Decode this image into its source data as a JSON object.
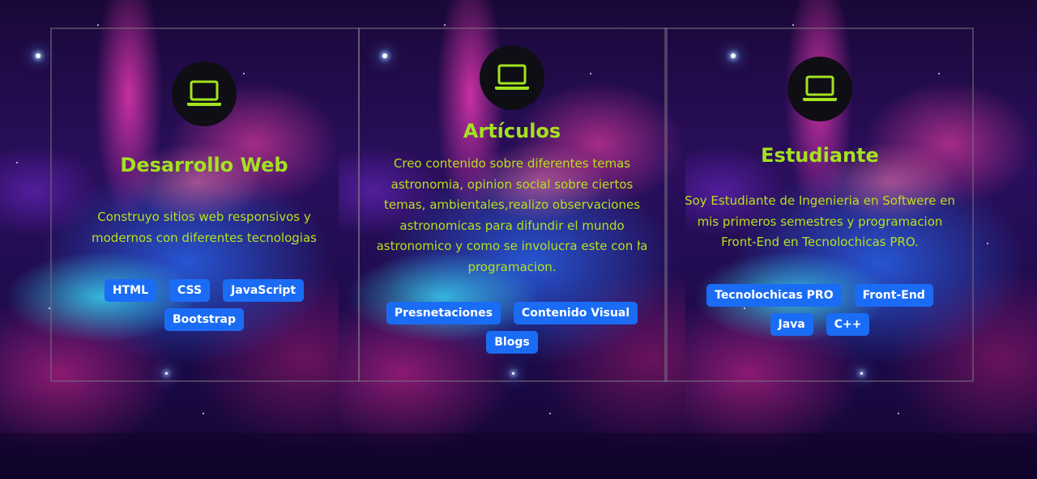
{
  "cards": [
    {
      "icon": "laptop-icon",
      "title": "Desarrollo Web",
      "description": "Construyo sitios web responsivos y modernos con diferentes tecnologias",
      "tags": [
        "HTML",
        "CSS",
        "JavaScript",
        "Bootstrap"
      ]
    },
    {
      "icon": "laptop-icon",
      "title": "Artículos",
      "description": "Creo contenido sobre diferentes temas astronomia, opinion social sobre ciertos temas, ambientales,realizo observaciones astronomicas para difundir el mundo astronomico y como se involucra este con la programacion.",
      "tags": [
        "Presnetaciones",
        "Contenido Visual",
        "Blogs"
      ]
    },
    {
      "icon": "laptop-icon",
      "title": "Estudiante",
      "description": "Soy Estudiante de Ingenieria en Softwere en mis primeros semestres y programacion Front-End en Tecnolochicas PRO.",
      "tags": [
        "Tecnolochicas PRO",
        "Front-End",
        "Java",
        "C++"
      ]
    }
  ],
  "colors": {
    "accent_green": "#a4e21f",
    "tag_blue": "#1a6cf5",
    "icon_bg": "#0e0e14"
  }
}
